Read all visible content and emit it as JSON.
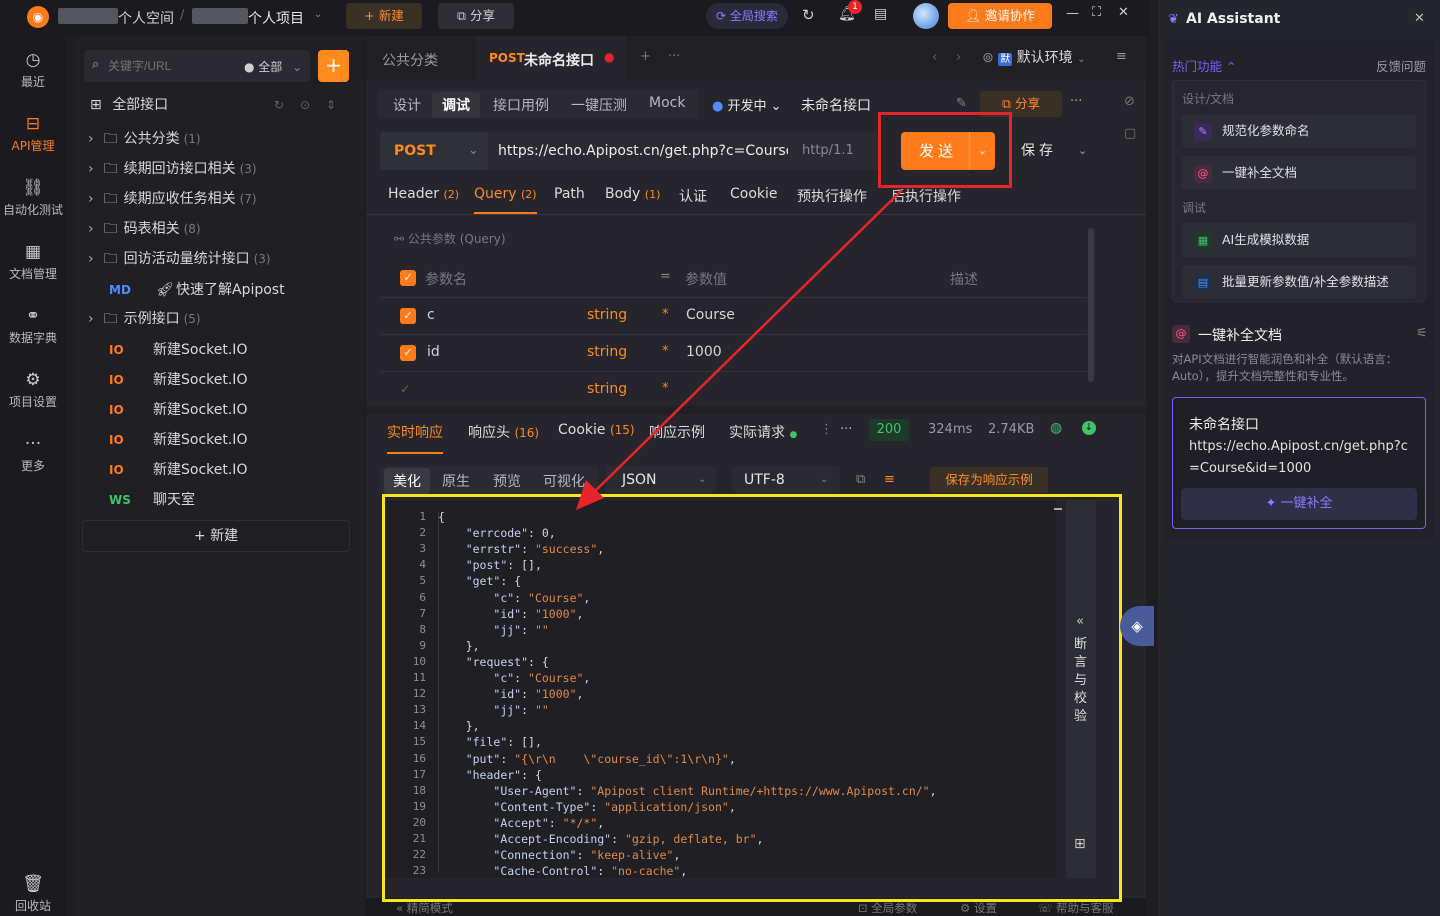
{
  "topbar": {
    "workspace": "个人空间",
    "project": "个人项目",
    "new_label": "新建",
    "share_label": "分享",
    "search_label": "全局搜索",
    "notif_count": "1",
    "invite_label": "邀请协作"
  },
  "rail": {
    "items": [
      {
        "label": "最近",
        "icon": "clock-icon"
      },
      {
        "label": "API管理",
        "icon": "api-icon"
      },
      {
        "label": "自动化测试",
        "icon": "automation-icon"
      },
      {
        "label": "文档管理",
        "icon": "doc-icon"
      },
      {
        "label": "数据字典",
        "icon": "dictionary-icon"
      },
      {
        "label": "项目设置",
        "icon": "settings-icon"
      },
      {
        "label": "更多",
        "icon": "more-icon"
      }
    ],
    "trash": "回收站"
  },
  "tree": {
    "search_placeholder": "关键字/URL",
    "filter": "全部",
    "root": "全部接口",
    "folders": [
      {
        "name": "公共分类",
        "count": "(1)"
      },
      {
        "name": "续期回访接口相关",
        "count": "(3)"
      },
      {
        "name": "续期应收任务相关",
        "count": "(7)"
      },
      {
        "name": "码表相关",
        "count": "(8)"
      },
      {
        "name": "回访活动量统计接口",
        "count": "(3)"
      }
    ],
    "md_item": {
      "tag": "MD",
      "name": "快速了解Apipost"
    },
    "example_folder": {
      "name": "示例接口",
      "count": "(5)"
    },
    "socket_items": [
      {
        "tag": "IO",
        "name": "新建Socket.IO"
      },
      {
        "tag": "IO",
        "name": "新建Socket.IO"
      },
      {
        "tag": "IO",
        "name": "新建Socket.IO"
      },
      {
        "tag": "IO",
        "name": "新建Socket.IO"
      },
      {
        "tag": "IO",
        "name": "新建Socket.IO"
      }
    ],
    "ws_item": {
      "tag": "WS",
      "name": "聊天室"
    },
    "new_label": "新建"
  },
  "main": {
    "breadcrumb": "公共分类",
    "tab_method": "POST",
    "tab_name": "未命名接口",
    "env": "默认环境",
    "env_badge": "默",
    "subtabs": [
      "设计",
      "调试",
      "接口用例",
      "一键压测",
      "Mock"
    ],
    "status": "开发中",
    "api_name": "未命名接口",
    "share": "分享",
    "method": "POST",
    "url": "https://echo.Apipost.cn/get.php?c=Course&ic",
    "protocol": "http/1.1",
    "send": "发送",
    "save": "保存",
    "req_tabs": [
      {
        "label": "Header",
        "count": "(2)"
      },
      {
        "label": "Query",
        "count": "(2)"
      },
      {
        "label": "Path",
        "count": ""
      },
      {
        "label": "Body",
        "count": "(1)"
      },
      {
        "label": "认证",
        "count": ""
      },
      {
        "label": "Cookie",
        "count": ""
      },
      {
        "label": "预执行操作",
        "count": ""
      },
      {
        "label": "后执行操作",
        "count": ""
      }
    ],
    "public_params": "公共参数 (Query)",
    "param_headers": {
      "name": "参数名",
      "value": "参数值",
      "desc": "描述"
    },
    "params": [
      {
        "name": "c",
        "type": "string",
        "value": "Course"
      },
      {
        "name": "id",
        "type": "string",
        "value": "1000"
      },
      {
        "name": "",
        "type": "string",
        "value": ""
      }
    ],
    "resp_tabs": [
      {
        "label": "实时响应",
        "count": ""
      },
      {
        "label": "响应头",
        "count": "(16)"
      },
      {
        "label": "Cookie",
        "count": "(15)"
      },
      {
        "label": "响应示例",
        "count": ""
      },
      {
        "label": "实际请求",
        "count": ""
      }
    ],
    "status_code": "200",
    "time": "324ms",
    "size": "2.74KB",
    "view_tabs": [
      "美化",
      "原生",
      "预览",
      "可视化"
    ],
    "format": "JSON",
    "encoding": "UTF-8",
    "save_example": "保存为响应示例",
    "assert_label": "断言与校验",
    "bottom": {
      "simple": "精简模式",
      "global": "全局参数",
      "settings": "设置",
      "help": "帮助与客服"
    }
  },
  "code_lines": [
    [
      "{",
      ""
    ],
    [
      "    \"errcode\": 0,",
      ""
    ],
    [
      "    \"errstr\": \"success\",",
      ""
    ],
    [
      "    \"post\": [],",
      ""
    ],
    [
      "    \"get\": {",
      ""
    ],
    [
      "        \"c\": \"Course\",",
      ""
    ],
    [
      "        \"id\": \"1000\",",
      ""
    ],
    [
      "        \"jj\": \"\"",
      ""
    ],
    [
      "    },",
      ""
    ],
    [
      "    \"request\": {",
      ""
    ],
    [
      "        \"c\": \"Course\",",
      ""
    ],
    [
      "        \"id\": \"1000\",",
      ""
    ],
    [
      "        \"jj\": \"\"",
      ""
    ],
    [
      "    },",
      ""
    ],
    [
      "    \"file\": [],",
      ""
    ],
    [
      "    \"put\": \"{\\r\\n    \\\"course_id\\\":1\\r\\n}\",",
      ""
    ],
    [
      "    \"header\": {",
      ""
    ],
    [
      "        \"User-Agent\": \"Apipost client Runtime/+https://www.Apipost.cn/\",",
      ""
    ],
    [
      "        \"Content-Type\": \"application/json\",",
      ""
    ],
    [
      "        \"Accept\": \"*/*\",",
      ""
    ],
    [
      "        \"Accept-Encoding\": \"gzip, deflate, br\",",
      ""
    ],
    [
      "        \"Connection\": \"keep-alive\",",
      ""
    ],
    [
      "        \"Cache-Control\": \"no-cache\",",
      ""
    ]
  ],
  "ai": {
    "title": "AI Assistant",
    "hot": "热门功能",
    "feedback": "反馈问题",
    "section_design": "设计/文档",
    "card1": "规范化参数命名",
    "card2": "一键补全文档",
    "section_debug": "调试",
    "card3": "AI生成模拟数据",
    "card4": "批量更新参数值/补全参数描述",
    "feature_title": "一键补全文档",
    "feature_desc": "对API文档进行智能润色和补全（默认语言：Auto），提升文档完整性和专业性。",
    "api_name": "未命名接口",
    "api_url": "https://echo.Apipost.cn/get.php?c=Course&id=1000",
    "complete_btn": "一键补全"
  },
  "colors": {
    "accent": "#ff7a1a",
    "highlight_red": "#e8242b",
    "highlight_yellow": "#f5e71b",
    "purple": "#7c5cff"
  }
}
